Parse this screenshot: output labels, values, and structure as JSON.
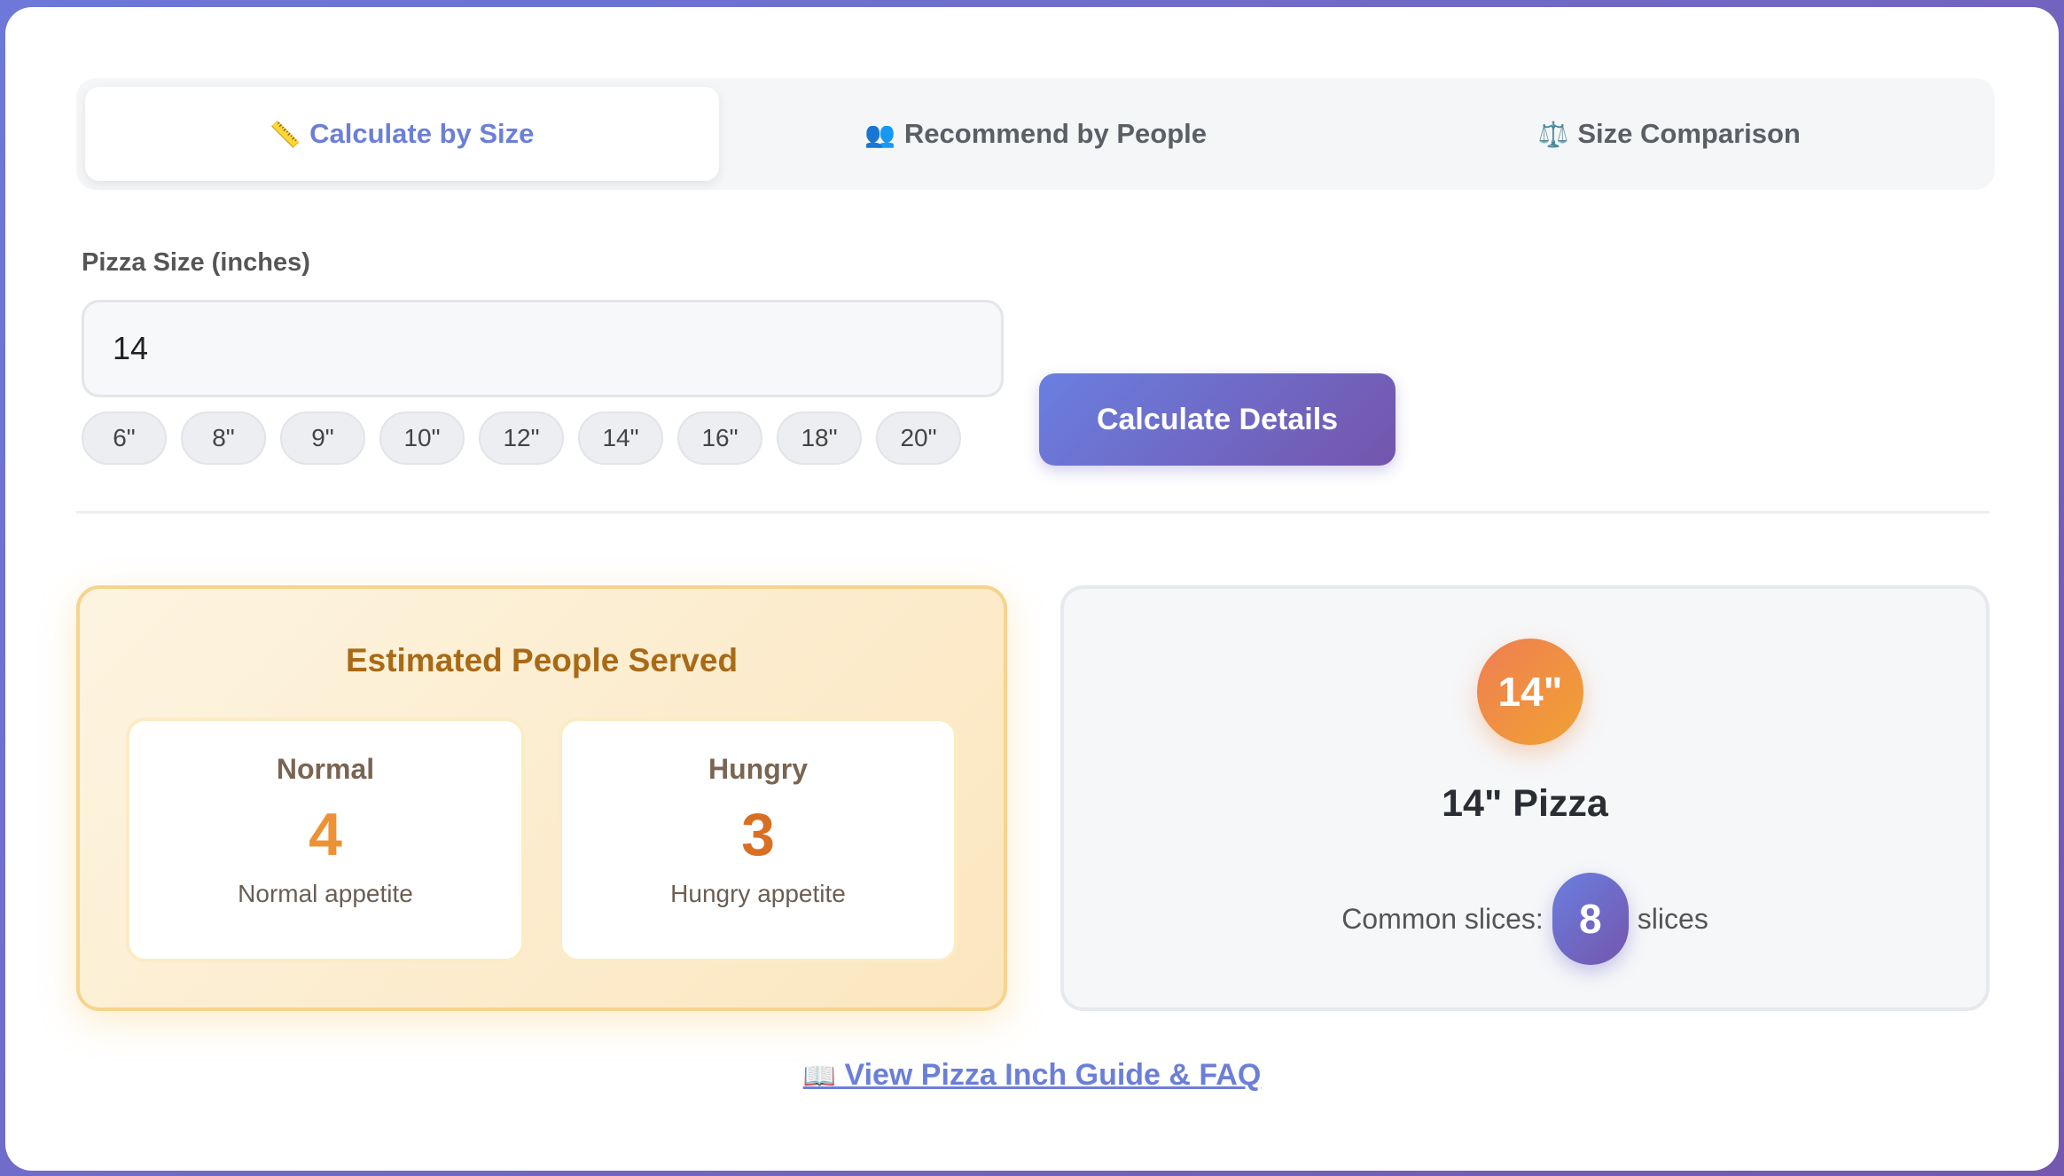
{
  "tabs": [
    {
      "icon": "📏",
      "label": "Calculate by Size",
      "active": true
    },
    {
      "icon": "👥",
      "label": "Recommend by People",
      "active": false
    },
    {
      "icon": "⚖️",
      "label": "Size Comparison",
      "active": false
    }
  ],
  "size_input": {
    "label": "Pizza Size (inches)",
    "value": "14"
  },
  "size_chips": [
    "6\"",
    "8\"",
    "9\"",
    "10\"",
    "12\"",
    "14\"",
    "16\"",
    "18\"",
    "20\""
  ],
  "calculate_button": "Calculate Details",
  "people": {
    "title": "Estimated People Served",
    "normal": {
      "label": "Normal",
      "count": "4",
      "desc": "Normal appetite"
    },
    "hungry": {
      "label": "Hungry",
      "count": "3",
      "desc": "Hungry appetite"
    }
  },
  "summary": {
    "badge": "14\"",
    "name": "14\" Pizza",
    "slices_prefix": "Common slices:",
    "slices_count": "8",
    "slices_suffix": "slices"
  },
  "guide_link": {
    "icon": "📖",
    "label": "View Pizza Inch Guide & FAQ"
  },
  "colors": {
    "accent": "#6b7fd8",
    "gradient_start": "#6a7fe0",
    "gradient_end": "#7455ac",
    "people_title": "#a86a16",
    "normal_count": "#ec9234",
    "hungry_count": "#d96f22",
    "badge_start": "#ee7e52",
    "badge_end": "#f1a233"
  }
}
